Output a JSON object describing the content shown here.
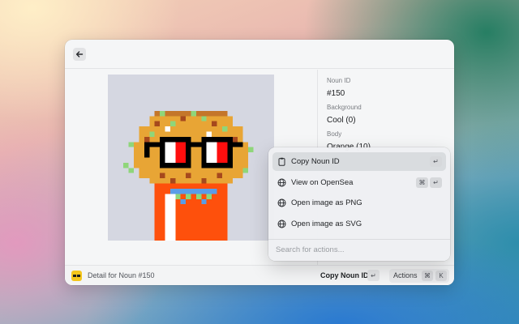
{
  "detail": {
    "metadata": [
      {
        "label": "Noun ID",
        "value": "#150"
      },
      {
        "label": "Background",
        "value": "Cool (0)"
      },
      {
        "label": "Body",
        "value": "Orange (10)"
      }
    ]
  },
  "footer": {
    "title": "Detail for Noun #150",
    "primary_action": "Copy Noun ID",
    "primary_shortcut": "↵",
    "actions_label": "Actions",
    "actions_keys": [
      "⌘",
      "K"
    ]
  },
  "action_panel": {
    "items": [
      {
        "label": "Copy Noun ID",
        "icon": "clipboard-icon",
        "shortcut": [
          "↵"
        ],
        "selected": true
      },
      {
        "label": "View on OpenSea",
        "icon": "globe-icon",
        "shortcut": [
          "⌘",
          "↵"
        ]
      },
      {
        "label": "Open image as PNG",
        "icon": "globe-icon",
        "shortcut": []
      },
      {
        "label": "Open image as SVG",
        "icon": "globe-icon",
        "shortcut": []
      }
    ],
    "search_placeholder": "Search for actions..."
  },
  "colors": {
    "noun_background": "#d5d7e1",
    "body": "#ff638d",
    "glasses_frame": "#000000",
    "glasses_lens_red": "#ff0e0e",
    "taco_shell": "#e8a535",
    "lettuce": "#8fd67a"
  }
}
